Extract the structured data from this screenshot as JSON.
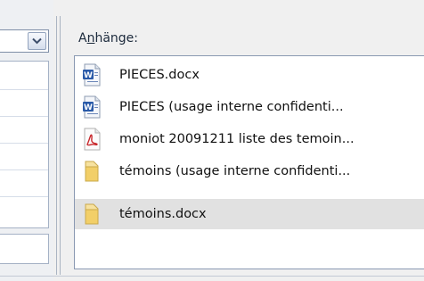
{
  "attachments_panel": {
    "label_prefix": "A",
    "label_mnemonic": "n",
    "label_suffix": "hänge:",
    "files": [
      {
        "name": "PIECES.docx",
        "icon": "word-document-icon",
        "selected": false
      },
      {
        "name": "PIECES (usage interne confidenti...",
        "icon": "word-document-icon",
        "selected": false
      },
      {
        "name": "moniot 20091211 liste des temoin...",
        "icon": "pdf-document-icon",
        "selected": false
      },
      {
        "name": "témoins (usage interne confidenti...",
        "icon": "folder-icon",
        "selected": false
      },
      {
        "name": "témoins.docx",
        "icon": "folder-icon",
        "selected": true
      }
    ]
  },
  "left_panel": {
    "dropdown_icon": "chevron-down-icon"
  },
  "colors": {
    "selection_background": "#e1e1e1",
    "word_icon_blue": "#2a5aa8",
    "pdf_icon_red": "#c8262a",
    "folder_icon_yellow": "#f2cf68"
  }
}
